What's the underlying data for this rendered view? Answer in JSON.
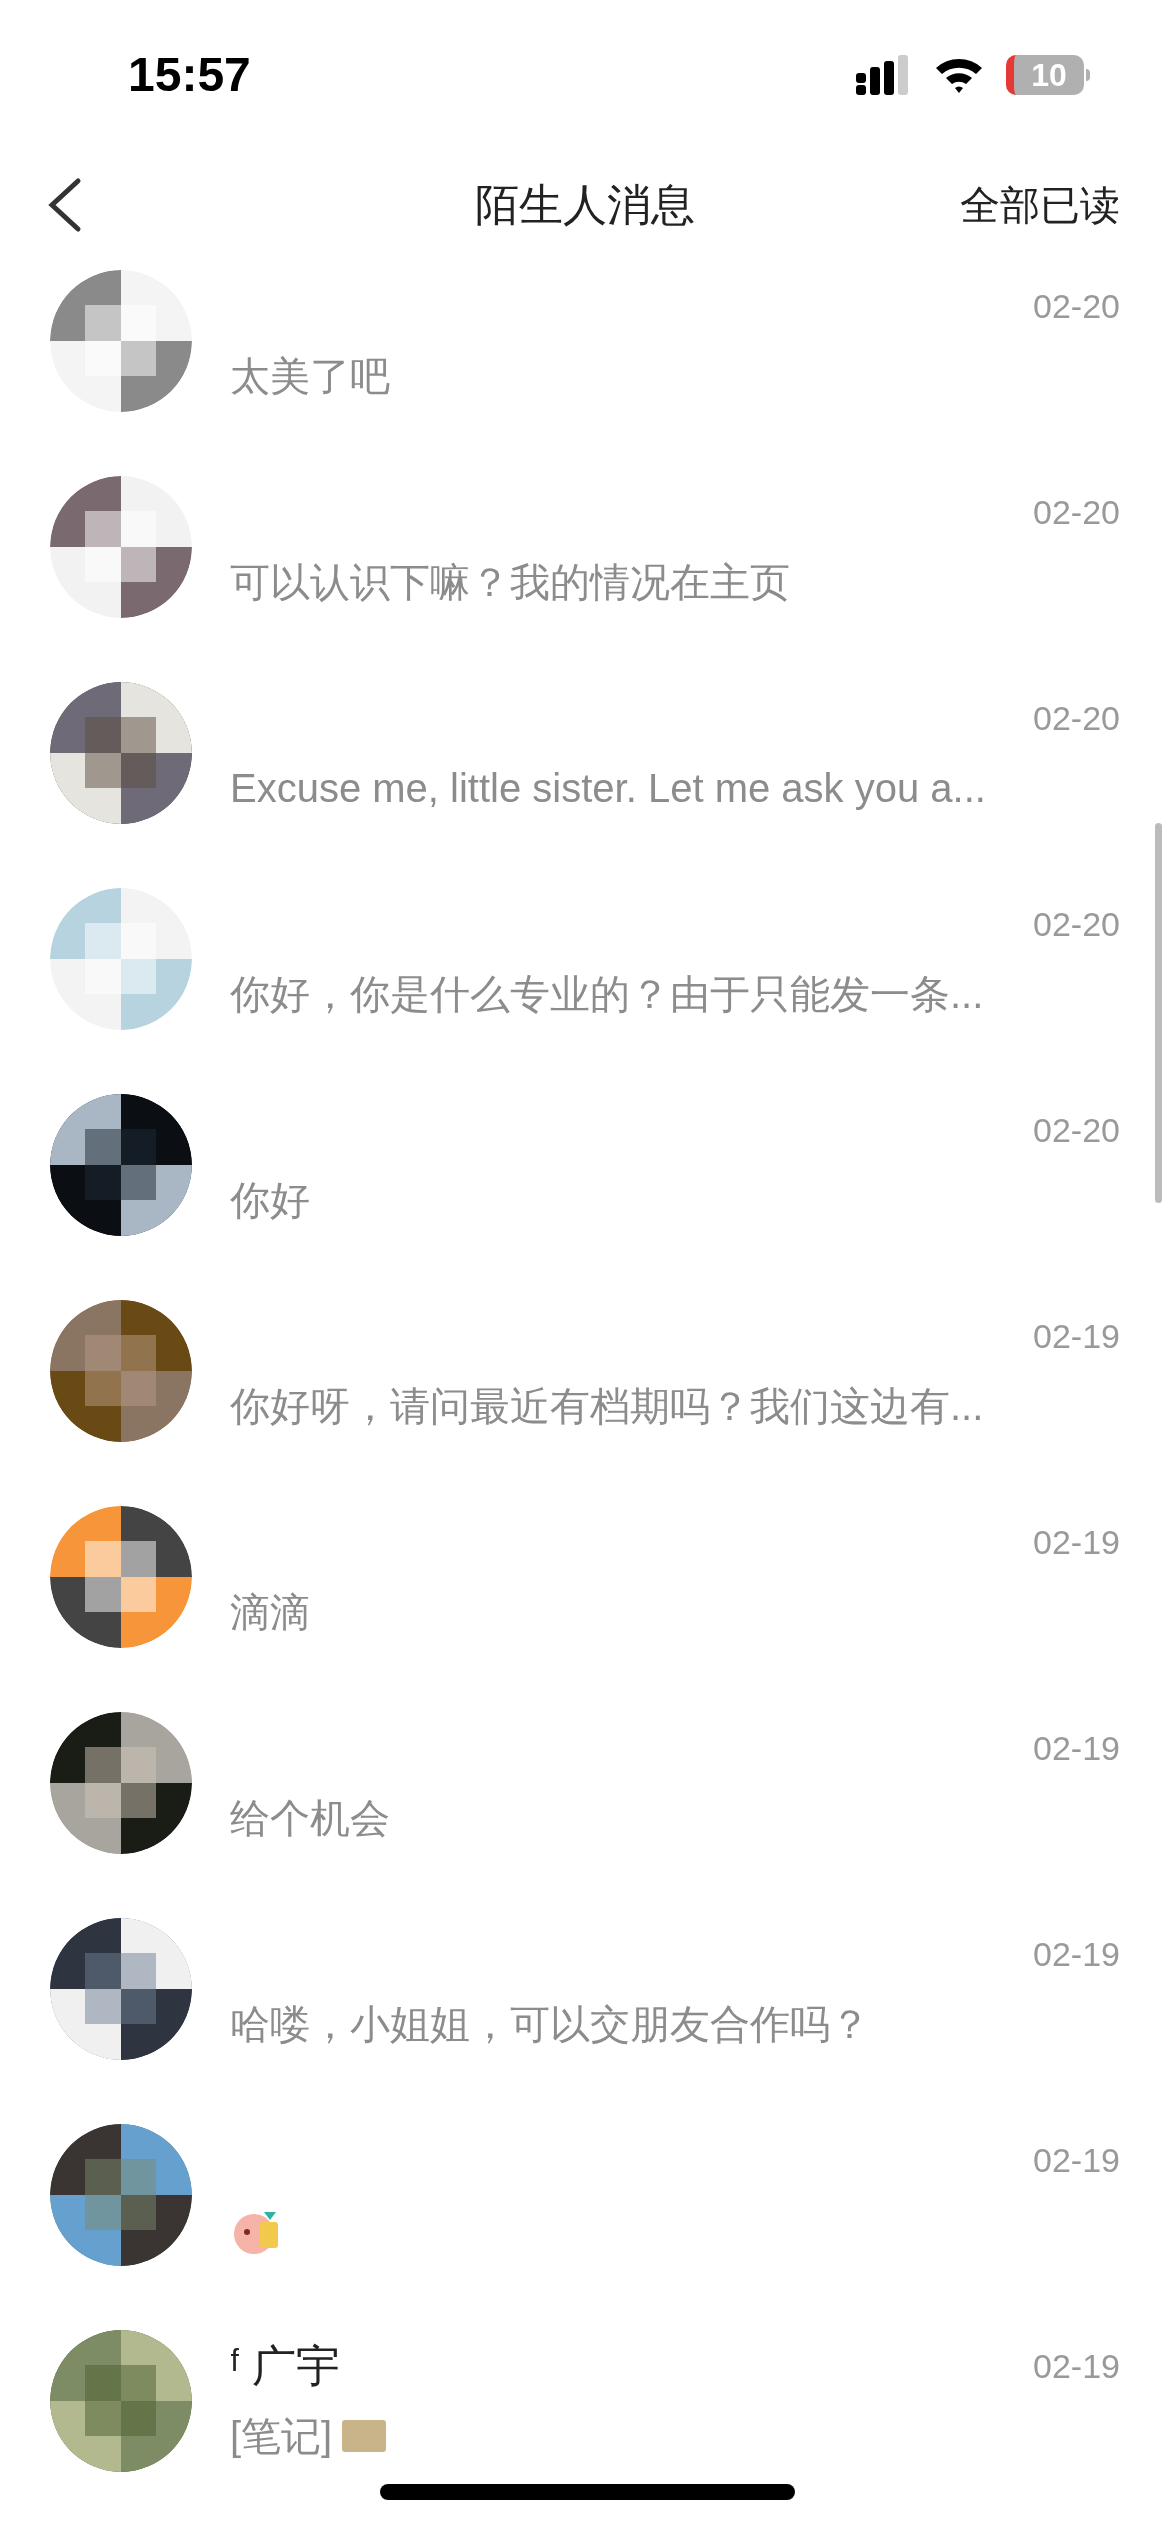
{
  "status_bar": {
    "time": "15:57",
    "battery": "10"
  },
  "header": {
    "title": "陌生人消息",
    "action": "全部已读"
  },
  "messages": [
    {
      "kind": "text",
      "date": "02-20",
      "message": "太美了吧"
    },
    {
      "kind": "text",
      "date": "02-20",
      "message": "可以认识下嘛？我的情况在主页"
    },
    {
      "kind": "text",
      "date": "02-20",
      "message": "Excuse me, little sister. Let me ask you a..."
    },
    {
      "kind": "text",
      "date": "02-20",
      "message": "你好，你是什么专业的？由于只能发一条..."
    },
    {
      "kind": "text",
      "date": "02-20",
      "message": "你好"
    },
    {
      "kind": "text",
      "date": "02-19",
      "message": "你好呀，请问最近有档期吗？我们这边有..."
    },
    {
      "kind": "text",
      "date": "02-19",
      "message": "滴滴"
    },
    {
      "kind": "text",
      "date": "02-19",
      "message": "给个机会"
    },
    {
      "kind": "text",
      "date": "02-19",
      "message": "哈喽，小姐姐，可以交朋友合作吗？"
    },
    {
      "kind": "sticker",
      "date": "02-19"
    },
    {
      "kind": "note",
      "name": "ᶠ 广宇",
      "date": "02-19",
      "message": "[笔记]"
    }
  ]
}
